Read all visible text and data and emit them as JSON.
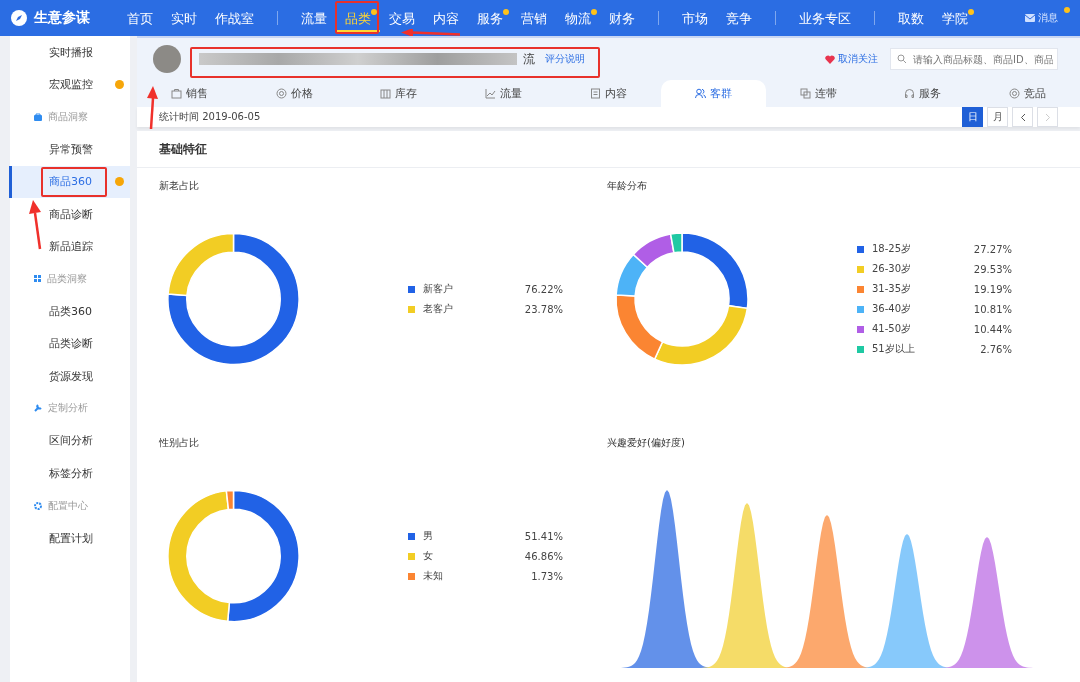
{
  "brand": {
    "name": "生意参谋"
  },
  "nav_groups": [
    [
      {
        "label": "首页",
        "selected": false,
        "dot": false
      },
      {
        "label": "实时",
        "selected": false,
        "dot": false
      },
      {
        "label": "作战室",
        "selected": false,
        "dot": false
      }
    ],
    [
      {
        "label": "流量",
        "selected": false,
        "dot": false
      },
      {
        "label": "品类",
        "selected": true,
        "dot": true
      },
      {
        "label": "交易",
        "selected": false,
        "dot": false
      },
      {
        "label": "内容",
        "selected": false,
        "dot": false
      },
      {
        "label": "服务",
        "selected": false,
        "dot": true
      },
      {
        "label": "营销",
        "selected": false,
        "dot": false
      },
      {
        "label": "物流",
        "selected": false,
        "dot": true
      },
      {
        "label": "财务",
        "selected": false,
        "dot": false
      }
    ],
    [
      {
        "label": "市场",
        "selected": false,
        "dot": false
      },
      {
        "label": "竞争",
        "selected": false,
        "dot": false
      }
    ],
    [
      {
        "label": "业务专区",
        "selected": false,
        "dot": false
      }
    ],
    [
      {
        "label": "取数",
        "selected": false,
        "dot": false
      },
      {
        "label": "学院",
        "selected": false,
        "dot": true
      }
    ]
  ],
  "messages": {
    "label": "消息",
    "dot": true
  },
  "sidebar": [
    {
      "items": [
        {
          "label": "实时播报",
          "selected": false,
          "dot": false
        },
        {
          "label": "宏观监控",
          "selected": false,
          "dot": true
        }
      ]
    },
    {
      "title": "商品洞察",
      "items": [
        {
          "label": "异常预警",
          "selected": false,
          "dot": false
        },
        {
          "label": "商品360",
          "selected": true,
          "dot": true
        },
        {
          "label": "商品诊断",
          "selected": false,
          "dot": false
        },
        {
          "label": "新品追踪",
          "selected": false,
          "dot": false
        }
      ]
    },
    {
      "title": "品类洞察",
      "items": [
        {
          "label": "品类360",
          "selected": false,
          "dot": false
        },
        {
          "label": "品类诊断",
          "selected": false,
          "dot": false
        },
        {
          "label": "货源发现",
          "selected": false,
          "dot": false
        }
      ]
    },
    {
      "title": "定制分析",
      "items": [
        {
          "label": "区间分析",
          "selected": false,
          "dot": false
        },
        {
          "label": "标签分析",
          "selected": false,
          "dot": false
        }
      ]
    },
    {
      "title": "配置中心",
      "items": [
        {
          "label": "配置计划",
          "selected": false,
          "dot": false
        }
      ]
    }
  ],
  "product": {
    "title_visible_end": "流",
    "rating_link": "评分说明",
    "follow": "取消关注",
    "search": {
      "placeholder": "请输入商品标题、商品ID、商品"
    }
  },
  "tabs": [
    {
      "label": "销售",
      "selected": false
    },
    {
      "label": "价格",
      "selected": false
    },
    {
      "label": "库存",
      "selected": false
    },
    {
      "label": "流量",
      "selected": false
    },
    {
      "label": "内容",
      "selected": false
    },
    {
      "label": "客群",
      "selected": true
    },
    {
      "label": "连带",
      "selected": false
    },
    {
      "label": "服务",
      "selected": false
    },
    {
      "label": "竞品",
      "selected": false
    }
  ],
  "stat_date": "统计时间 2019-06-05",
  "periods": [
    {
      "label": "日",
      "selected": true
    },
    {
      "label": "月",
      "selected": false
    }
  ],
  "pager": {
    "prev_disabled": false,
    "next_disabled": true
  },
  "section_title": "基础特征",
  "panels": [
    {
      "title": "新老占比",
      "legend": [
        {
          "color": "#2162e6",
          "value": "76.22%"
        },
        {
          "color": "#f2cd24",
          "value": "23.78%"
        }
      ],
      "chart_data": {
        "type": "donut",
        "categories": [
          "新客户",
          "老客户"
        ],
        "series": [
          {
            "values": [
              76.22,
              23.78
            ]
          }
        ]
      }
    },
    {
      "title": "年龄分布",
      "legend": [
        {
          "color": "#2162e6",
          "value": "27.27%"
        },
        {
          "color": "#f2cd24",
          "value": "29.53%"
        },
        {
          "color": "#fb8532",
          "value": "19.19%"
        },
        {
          "color": "#4db3f7",
          "value": "10.81%"
        },
        {
          "color": "#b05ee6",
          "value": "10.44%"
        },
        {
          "color": "#1fc9a3",
          "value": "2.76%"
        }
      ],
      "chart_data": {
        "type": "donut",
        "categories": [
          "18-25岁",
          "26-30岁",
          "31-35岁",
          "36-40岁",
          "41-50岁",
          "51岁以上"
        ],
        "series": [
          {
            "values": [
              27.27,
              29.53,
              19.19,
              10.81,
              10.44,
              2.76
            ]
          }
        ]
      }
    },
    {
      "title": "性别占比",
      "legend": [
        {
          "color": "#2162e6",
          "value": "51.41%"
        },
        {
          "color": "#f2cd24",
          "value": "46.86%"
        },
        {
          "color": "#fb8532",
          "value": "1.73%"
        }
      ],
      "chart_data": {
        "type": "donut",
        "categories": [
          "男",
          "女",
          "未知"
        ],
        "series": [
          {
            "values": [
              51.41,
              46.86,
              1.73
            ]
          }
        ]
      }
    },
    {
      "title": "兴趣爱好(偏好度)"
    }
  ]
}
